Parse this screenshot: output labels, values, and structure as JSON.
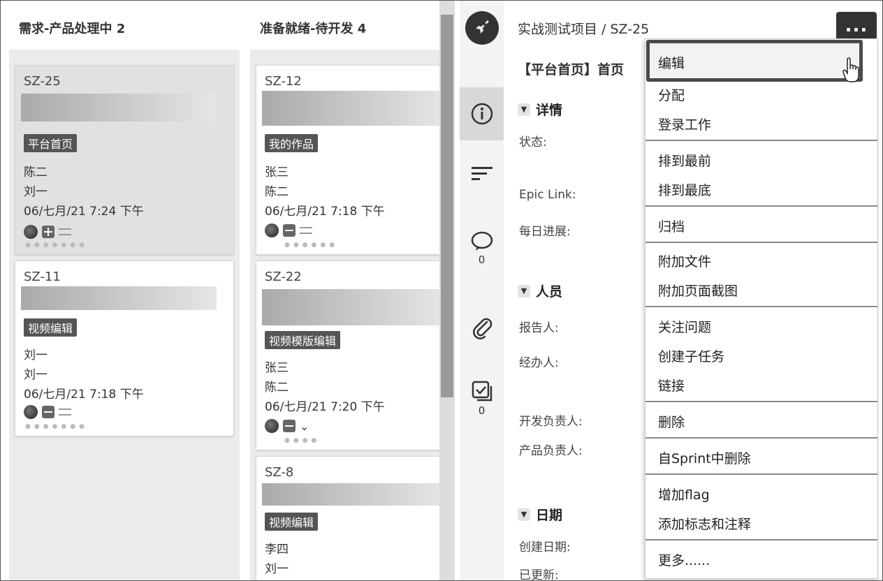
{
  "columns": [
    {
      "title": "需求-产品处理中 2",
      "cards": [
        {
          "key": "SZ-25",
          "tag": "平台首页",
          "line1": "陈二",
          "line2": "刘一",
          "date": "06/七月/21 7:24 下午"
        },
        {
          "key": "SZ-11",
          "tag": "视频编辑",
          "line1": "刘一",
          "line2": "刘一",
          "date": "06/七月/21 7:18 下午"
        }
      ]
    },
    {
      "title": "准备就绪-待开发 4",
      "cards": [
        {
          "key": "SZ-12",
          "tag": "我的作品",
          "line1": "张三",
          "line2": "陈二",
          "date": "06/七月/21 7:18 下午"
        },
        {
          "key": "SZ-22",
          "tag": "视频模版编辑",
          "line1": "张三",
          "line2": "陈二",
          "date": "06/七月/21 7:20 下午"
        },
        {
          "key": "SZ-8",
          "tag": "视频编辑",
          "line1": "李四",
          "line2": "刘一",
          "date": ""
        }
      ]
    }
  ],
  "rail": {
    "comments_count": "0",
    "subtasks_count": "0",
    "icons": [
      "rocket-avatar",
      "info-icon",
      "list-icon",
      "comment-icon",
      "attachment-icon",
      "subtask-icon"
    ]
  },
  "detail": {
    "breadcrumb": "实战测试项目 / SZ-25",
    "more_label": "...",
    "issue_title": "【平台首页】首页",
    "sections": {
      "details": "详情",
      "people": "人员",
      "dates": "日期"
    },
    "labels": {
      "status": "状态:",
      "epic_link": "Epic Link:",
      "daily_progress": "每日进展:",
      "reporter": "报告人:",
      "assignee": "经办人:",
      "dev_owner": "开发负责人:",
      "product_owner": "产品负责人:",
      "created": "创建日期:",
      "updated": "已更新:"
    }
  },
  "menu": {
    "items": [
      "编辑",
      "分配",
      "登录工作",
      "排到最前",
      "排到最底",
      "归档",
      "附加文件",
      "附加页面截图",
      "关注问题",
      "创建子任务",
      "链接",
      "删除",
      "自Sprint中删除",
      "增加flag",
      "添加标志和注释",
      "更多......"
    ]
  }
}
